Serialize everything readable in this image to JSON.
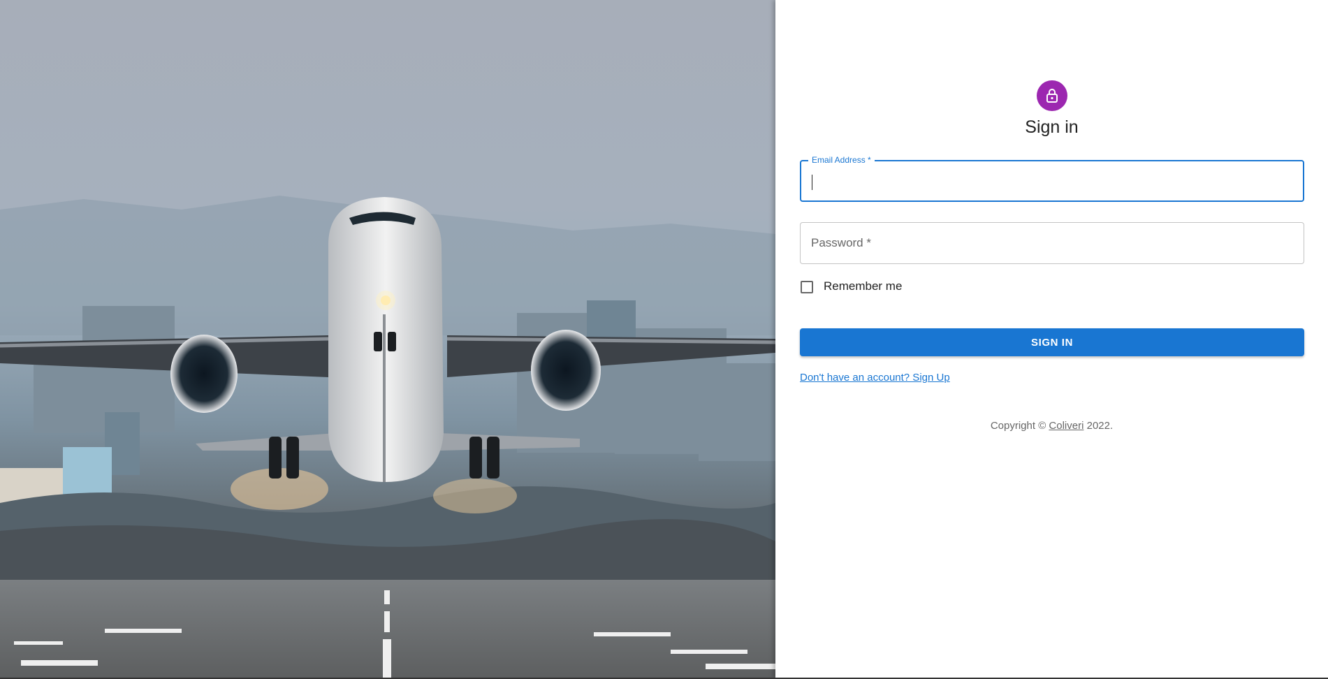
{
  "hero": {
    "image": "airplane-taking-off"
  },
  "form": {
    "title": "Sign in",
    "icon": "lock-icon",
    "accent_color": "#9c27b0",
    "primary_color": "#1976d2",
    "email": {
      "label": "Email Address *",
      "value": ""
    },
    "password": {
      "placeholder": "Password *",
      "value": ""
    },
    "remember_label": "Remember me",
    "remember_checked": false,
    "submit_label": "SIGN IN",
    "signup_link": "Don't have an account? Sign Up"
  },
  "footer": {
    "copyright_prefix": "Copyright ©",
    "company": "Coliveri",
    "year_suffix": "2022."
  }
}
